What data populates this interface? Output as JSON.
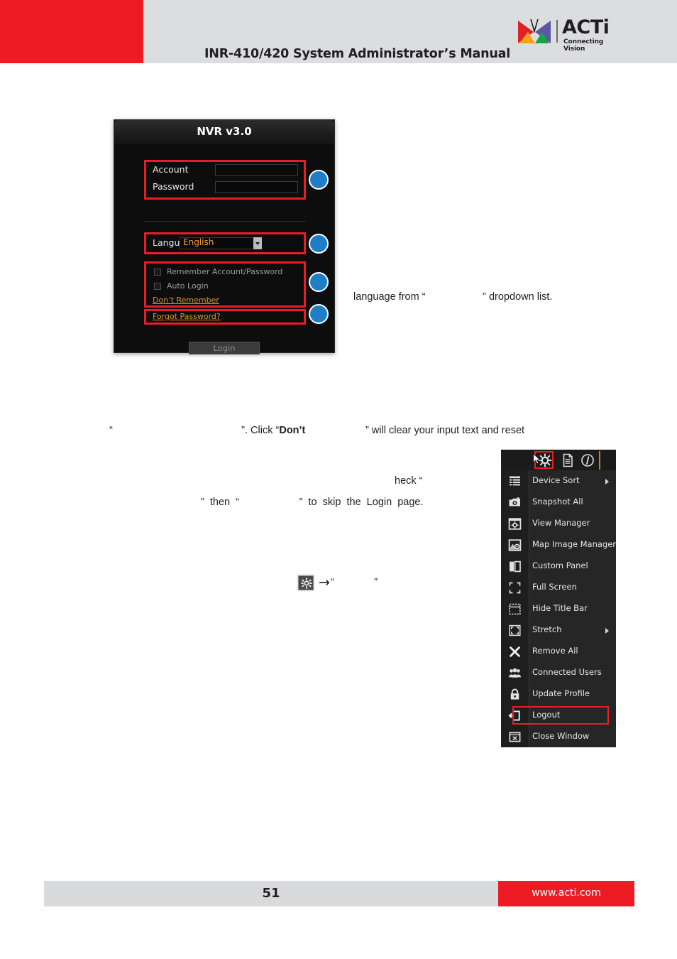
{
  "header": {
    "title": "INR-410/420 System Administrator’s Manual",
    "logo": {
      "wordmark": "ACTi",
      "tagline": "Connecting Vision"
    }
  },
  "login_dialog": {
    "title": "NVR v3.0",
    "account_label": "Account",
    "account_value": "",
    "password_label": "Password",
    "password_value": "",
    "language_label": "Language",
    "language_value": "English",
    "remember_label": "Remember Account/Password",
    "auto_login_label": "Auto Login",
    "dont_remember_label": "Don’t Remember",
    "forgot_password_label": "Forgot Password?",
    "login_button_label": "Login",
    "callout_color": "#ec1c24",
    "marker_color": "#1e7fc6",
    "markers": [
      "",
      "",
      "",
      ""
    ]
  },
  "prose": {
    "line_language": "language from “                    ” dropdown list.",
    "line_dont_pre": "“                                             ”. Click “",
    "line_dont_bold": "Don’t",
    "line_dont_post": "                     ” will clear your input text and reset",
    "line_check": "heck “",
    "line_then": "”  then  “                     ”  to  skip  the  Login  page.",
    "line_gear_quote": "“              ”"
  },
  "context_menu": {
    "toolbar_icons": [
      "gear-icon",
      "document-icon",
      "info-icon"
    ],
    "highlighted_toolbar_icon": "gear-icon",
    "items": [
      {
        "label": "Device Sort",
        "icon": "list-icon",
        "submenu": true,
        "highlighted": false
      },
      {
        "label": "Snapshot All",
        "icon": "camera-icon",
        "submenu": false,
        "highlighted": false
      },
      {
        "label": "View Manager",
        "icon": "view-gear-icon",
        "submenu": false,
        "highlighted": false
      },
      {
        "label": "Map Image Manager",
        "icon": "map-gear-icon",
        "submenu": false,
        "highlighted": false
      },
      {
        "label": "Custom Panel",
        "icon": "panel-icon",
        "submenu": false,
        "highlighted": false
      },
      {
        "label": "Full Screen",
        "icon": "fullscreen-icon",
        "submenu": false,
        "highlighted": false
      },
      {
        "label": "Hide Title Bar",
        "icon": "hide-titlebar-icon",
        "submenu": false,
        "highlighted": false
      },
      {
        "label": "Stretch",
        "icon": "stretch-icon",
        "submenu": true,
        "highlighted": false
      },
      {
        "label": "Remove All",
        "icon": "close-x-icon",
        "submenu": false,
        "highlighted": false
      },
      {
        "label": "Connected Users",
        "icon": "users-icon",
        "submenu": false,
        "highlighted": false
      },
      {
        "label": "Update Profile",
        "icon": "lock-icon",
        "submenu": false,
        "highlighted": false
      },
      {
        "label": "Logout",
        "icon": "logout-icon",
        "submenu": false,
        "highlighted": true
      },
      {
        "label": "Close Window",
        "icon": "close-window-icon",
        "submenu": false,
        "highlighted": false
      }
    ]
  },
  "footer": {
    "page_number": "51",
    "url": "www.acti.com"
  }
}
